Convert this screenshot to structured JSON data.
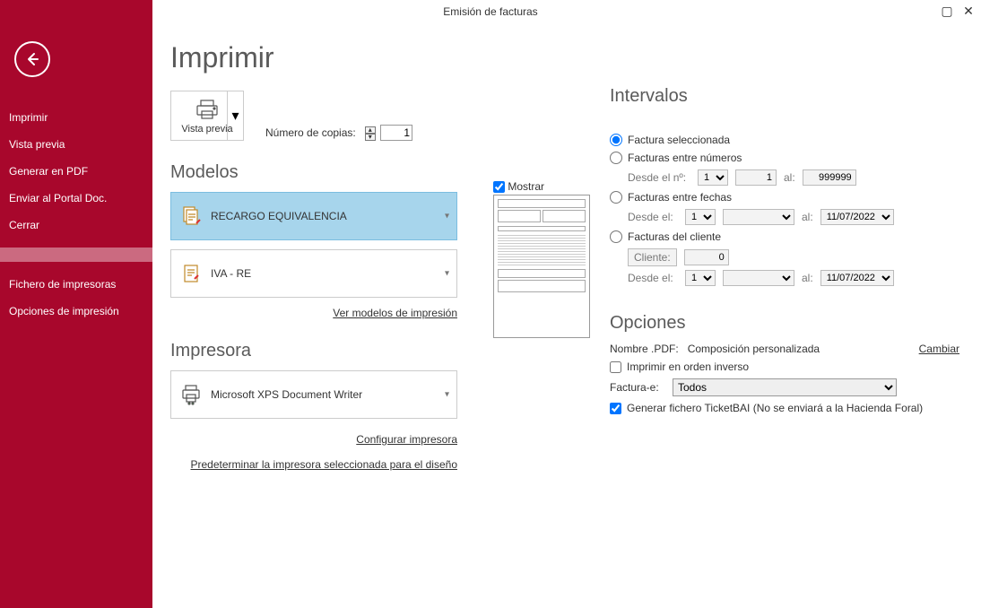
{
  "window": {
    "title": "Emisión de facturas"
  },
  "sidebar": {
    "items": [
      "Imprimir",
      "Vista previa",
      "Generar en PDF",
      "Enviar al Portal Doc.",
      "Cerrar"
    ],
    "items2": [
      "Fichero de impresoras",
      "Opciones de impresión"
    ]
  },
  "page": {
    "heading": "Imprimir",
    "preview_label": "Vista previa",
    "copies_label": "Número de copias:",
    "copies_value": "1",
    "modelos_heading": "Modelos",
    "model1": "RECARGO EQUIVALENCIA",
    "model2": "IVA - RE",
    "ver_modelos": "Ver modelos de impresión",
    "mostrar": "Mostrar",
    "impresora_heading": "Impresora",
    "printer": "Microsoft XPS Document Writer",
    "config_printer": "Configurar impresora",
    "predet_printer": "Predeterminar la impresora seleccionada para el diseño"
  },
  "intervalos": {
    "heading": "Intervalos",
    "r1": "Factura seleccionada",
    "r2": "Facturas entre números",
    "r2_desde": "Desde el nº:",
    "r2_d1": "1",
    "r2_d2": "1",
    "r2_al": "al:",
    "r2_hasta": "999999",
    "r3": "Facturas entre fechas",
    "r3_desde": "Desde el:",
    "r3_d1": "1",
    "r3_al": "al:",
    "r3_hasta": "11/07/2022",
    "r4": "Facturas del cliente",
    "r4_cliente": "Cliente:",
    "r4_cval": "0",
    "r4_desde": "Desde el:",
    "r4_d1": "1",
    "r4_al": "al:",
    "r4_hasta": "11/07/2022"
  },
  "opciones": {
    "heading": "Opciones",
    "pdf_label": "Nombre .PDF:",
    "pdf_value": "Composición personalizada",
    "cambiar": "Cambiar",
    "inverso": "Imprimir en orden inverso",
    "facturae_label": "Factura-e:",
    "facturae_value": "Todos",
    "ticketbai": "Generar fichero TicketBAI (No se enviará a la Hacienda Foral)"
  }
}
